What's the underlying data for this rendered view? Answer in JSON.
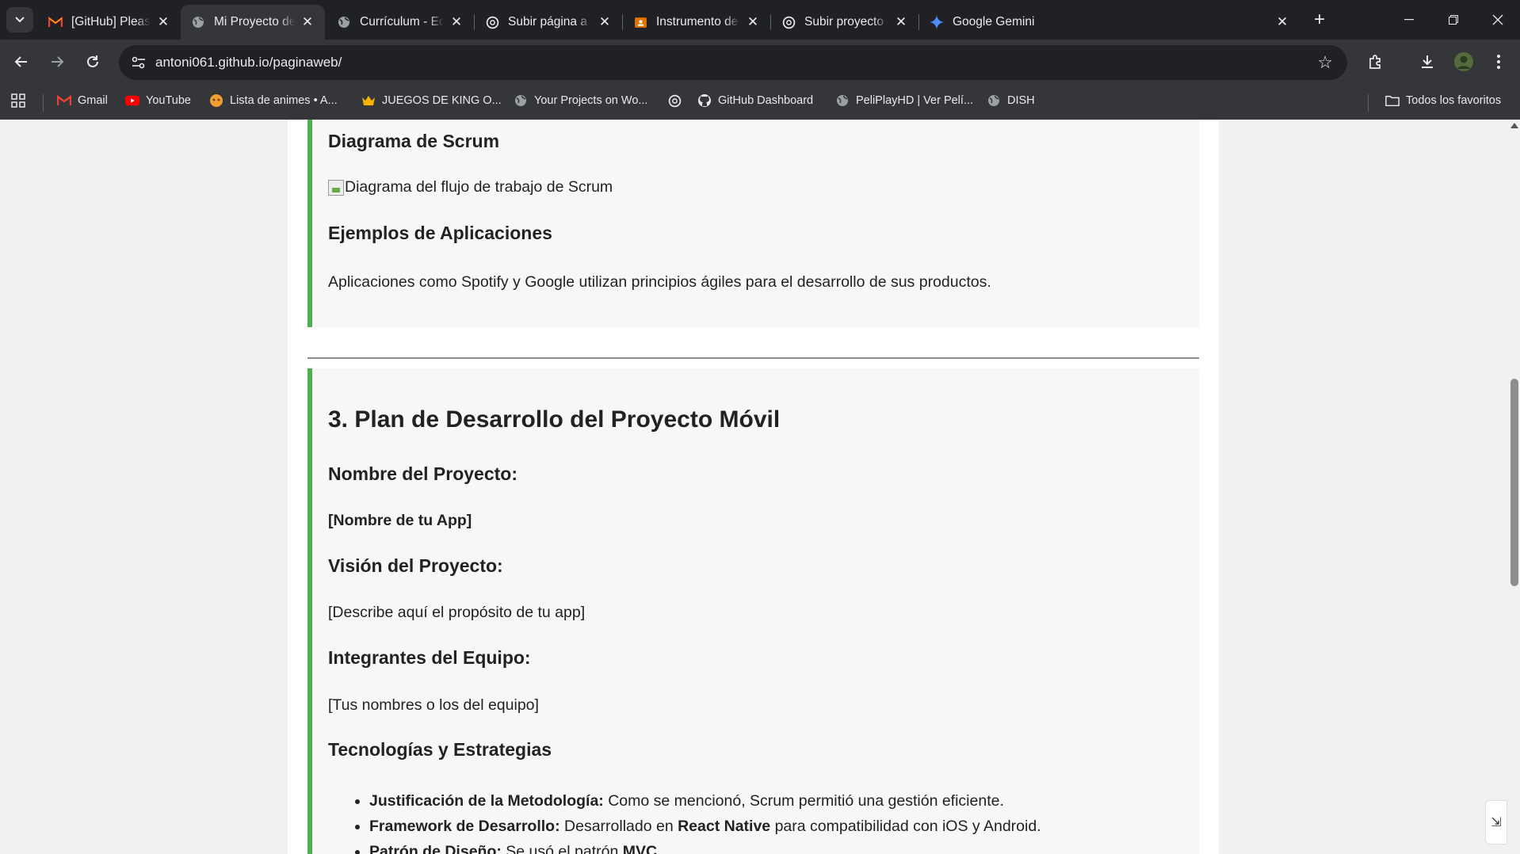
{
  "browser": {
    "tabs": [
      {
        "title": "[GitHub] Please verify your device",
        "icon": "gmail-icon",
        "active": false
      },
      {
        "title": "Mi Proyecto de Aplicaciones",
        "icon": "globe-icon",
        "active": true
      },
      {
        "title": "Currículum - Eduardo",
        "icon": "globe-icon",
        "active": false
      },
      {
        "title": "Subir página a GitHub",
        "icon": "openai-icon",
        "active": false
      },
      {
        "title": "Instrumento de Evaluación",
        "icon": "classroom-icon",
        "active": false
      },
      {
        "title": "Subir proyecto a GitHub",
        "icon": "openai-icon",
        "active": false
      },
      {
        "title": "Google Gemini",
        "icon": "gemini-icon",
        "active": false
      }
    ],
    "url": "antoni061.github.io/paginaweb/",
    "bookmarks": [
      {
        "label": "Gmail",
        "icon": "gmail-icon"
      },
      {
        "label": "YouTube",
        "icon": "youtube-icon"
      },
      {
        "label": "Lista de animes • A...",
        "icon": "anime-icon"
      },
      {
        "label": "JUEGOS DE KING O...",
        "icon": "crown-icon"
      },
      {
        "label": "Your Projects on Wo...",
        "icon": "globe-icon"
      },
      {
        "label": "",
        "icon": "openai-icon"
      },
      {
        "label": "GitHub Dashboard",
        "icon": "github-icon"
      },
      {
        "label": "PeliPlayHD | Ver Pelí...",
        "icon": "globe-icon"
      },
      {
        "label": "DISH",
        "icon": "globe-icon"
      }
    ],
    "all_bookmarks": "Todos los favoritos",
    "colors": {
      "accent_border": "#4caf50",
      "chrome_dark": "#202124",
      "chrome_mid": "#35363a"
    }
  },
  "page": {
    "section1": {
      "scrum_heading": "Diagrama de Scrum",
      "scrum_img_alt": "Diagrama del flujo de trabajo de Scrum",
      "examples_heading": "Ejemplos de Aplicaciones",
      "examples_text": "Aplicaciones como Spotify y Google utilizan principios ágiles para el desarrollo de sus productos."
    },
    "section2": {
      "title": "3. Plan de Desarrollo del Proyecto Móvil",
      "name_heading": "Nombre del Proyecto:",
      "name_value": "[Nombre de tu App]",
      "vision_heading": "Visión del Proyecto:",
      "vision_value": "[Describe aquí el propósito de tu app]",
      "team_heading": "Integrantes del Equipo:",
      "team_value": "[Tus nombres o los del equipo]",
      "tech_heading": "Tecnologías y Estrategias",
      "tech_items": [
        {
          "label": "Justificación de la Metodología:",
          "text": " Como se mencionó, Scrum permitió una gestión eficiente.",
          "bold2": "",
          "tail": ""
        },
        {
          "label": "Framework de Desarrollo:",
          "text": " Desarrollado en ",
          "bold2": "React Native",
          "tail": " para compatibilidad con iOS y Android."
        },
        {
          "label": "Patrón de Diseño:",
          "text": " Se usó el patrón ",
          "bold2": "MVC",
          "tail": "."
        }
      ]
    }
  }
}
